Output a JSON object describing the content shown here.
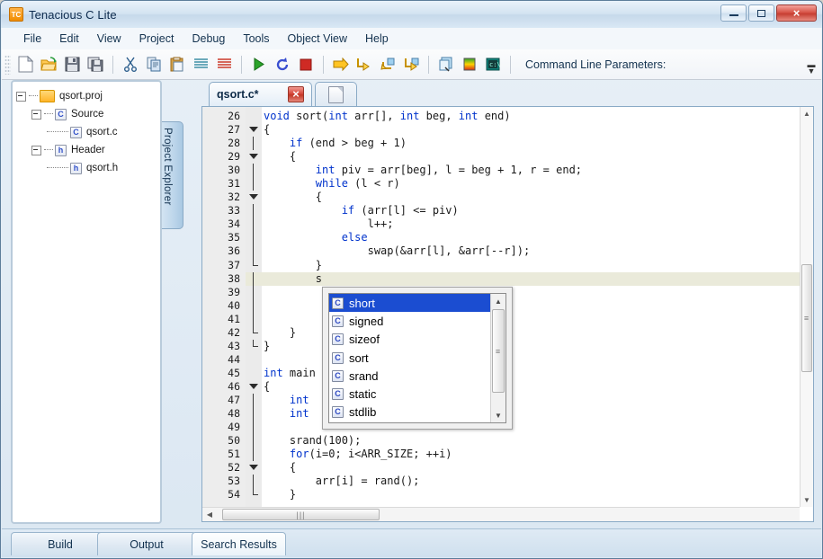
{
  "window": {
    "title": "Tenacious C Lite",
    "icon": "TC",
    "buttons": {
      "minimize": "minimize-button",
      "maximize": "maximize-button",
      "close": "×"
    }
  },
  "menu": {
    "items": [
      "File",
      "Edit",
      "View",
      "Project",
      "Debug",
      "Tools",
      "Object View",
      "Help"
    ]
  },
  "toolbar": {
    "groups": [
      [
        "new-file-icon",
        "open-folder-icon",
        "save-icon",
        "save-all-icon"
      ],
      [
        "cut-icon",
        "copy-icon",
        "paste-icon",
        "indent-icon",
        "comment-icon"
      ],
      [
        "run-icon",
        "restart-icon",
        "stop-icon"
      ],
      [
        "step-over-icon",
        "step-into-icon",
        "step-out-icon",
        "run-to-cursor-icon"
      ],
      [
        "watch-icon",
        "memory-icon",
        "console-icon"
      ]
    ],
    "command_line_label": "Command Line Parameters:"
  },
  "project_explorer": {
    "tab_label": "Project Explorer",
    "tree": [
      {
        "label": "qsort.proj",
        "icon": "folder-icon",
        "depth": 0,
        "expander": "minus"
      },
      {
        "label": "Source",
        "icon": "c-icon",
        "depth": 1,
        "expander": "minus"
      },
      {
        "label": "qsort.c",
        "icon": "c-icon",
        "depth": 2,
        "expander": "none"
      },
      {
        "label": "Header",
        "icon": "h-icon",
        "depth": 1,
        "expander": "minus"
      },
      {
        "label": "qsort.h",
        "icon": "h-icon",
        "depth": 2,
        "expander": "none"
      }
    ]
  },
  "editor": {
    "tabs": [
      {
        "label": "qsort.c*",
        "active": true,
        "close": "×"
      },
      {
        "label": "",
        "active": false,
        "icon": "new-document-icon"
      }
    ],
    "first_line": 26,
    "lines": [
      {
        "num": 26,
        "text": "void sort(int arr[], int beg, int end)",
        "fold": "none"
      },
      {
        "num": 27,
        "text": "{",
        "fold": "triangle"
      },
      {
        "num": 28,
        "text": "    if (end > beg + 1)",
        "fold": "bar"
      },
      {
        "num": 29,
        "text": "    {",
        "fold": "triangle"
      },
      {
        "num": 30,
        "text": "        int piv = arr[beg], l = beg + 1, r = end;",
        "fold": "bar"
      },
      {
        "num": 31,
        "text": "        while (l < r)",
        "fold": "bar"
      },
      {
        "num": 32,
        "text": "        {",
        "fold": "triangle"
      },
      {
        "num": 33,
        "text": "            if (arr[l] <= piv)",
        "fold": "bar"
      },
      {
        "num": 34,
        "text": "                l++;",
        "fold": "bar"
      },
      {
        "num": 35,
        "text": "            else",
        "fold": "bar"
      },
      {
        "num": 36,
        "text": "                swap(&arr[l], &arr[--r]);",
        "fold": "bar"
      },
      {
        "num": 37,
        "text": "        }",
        "fold": "corner"
      },
      {
        "num": 38,
        "text": "        s",
        "fold": "bar",
        "highlight": true
      },
      {
        "num": 39,
        "text": "",
        "fold": "bar"
      },
      {
        "num": 40,
        "text": "",
        "fold": "bar"
      },
      {
        "num": 41,
        "text": "",
        "fold": "bar"
      },
      {
        "num": 42,
        "text": "    }",
        "fold": "corner"
      },
      {
        "num": 43,
        "text": "}",
        "fold": "corner"
      },
      {
        "num": 44,
        "text": "",
        "fold": "none"
      },
      {
        "num": 45,
        "text": "int main",
        "fold": "none"
      },
      {
        "num": 46,
        "text": "{",
        "fold": "triangle"
      },
      {
        "num": 47,
        "text": "    int",
        "fold": "bar"
      },
      {
        "num": 48,
        "text": "    int",
        "fold": "bar"
      },
      {
        "num": 49,
        "text": "",
        "fold": "bar"
      },
      {
        "num": 50,
        "text": "    srand(100);",
        "fold": "bar"
      },
      {
        "num": 51,
        "text": "    for(i=0; i<ARR_SIZE; ++i)",
        "fold": "bar"
      },
      {
        "num": 52,
        "text": "    {",
        "fold": "triangle"
      },
      {
        "num": 53,
        "text": "        arr[i] = rand();",
        "fold": "bar"
      },
      {
        "num": 54,
        "text": "    }",
        "fold": "corner"
      }
    ],
    "keywords": [
      "void",
      "int",
      "if",
      "while",
      "else",
      "for"
    ]
  },
  "autocomplete": {
    "items": [
      {
        "label": "short",
        "icon": "c-icon",
        "selected": true
      },
      {
        "label": "signed",
        "icon": "c-icon",
        "selected": false
      },
      {
        "label": "sizeof",
        "icon": "c-icon",
        "selected": false
      },
      {
        "label": "sort",
        "icon": "c-icon",
        "selected": false
      },
      {
        "label": "srand",
        "icon": "c-icon",
        "selected": false
      },
      {
        "label": "static",
        "icon": "c-icon",
        "selected": false
      },
      {
        "label": "stdlib",
        "icon": "c-icon",
        "selected": false
      }
    ],
    "scroll_up": "▲",
    "scroll_down": "▼"
  },
  "bottom_tabs": [
    {
      "label": "Build",
      "active": false
    },
    {
      "label": "Output",
      "active": false
    },
    {
      "label": "Search Results",
      "active": true
    }
  ],
  "colors": {
    "keyword": "#0033cc",
    "selection": "#1b4dd1",
    "current_line": "#eaeada",
    "title_text": "#0c2a4d",
    "close_button": "#c63f32"
  }
}
